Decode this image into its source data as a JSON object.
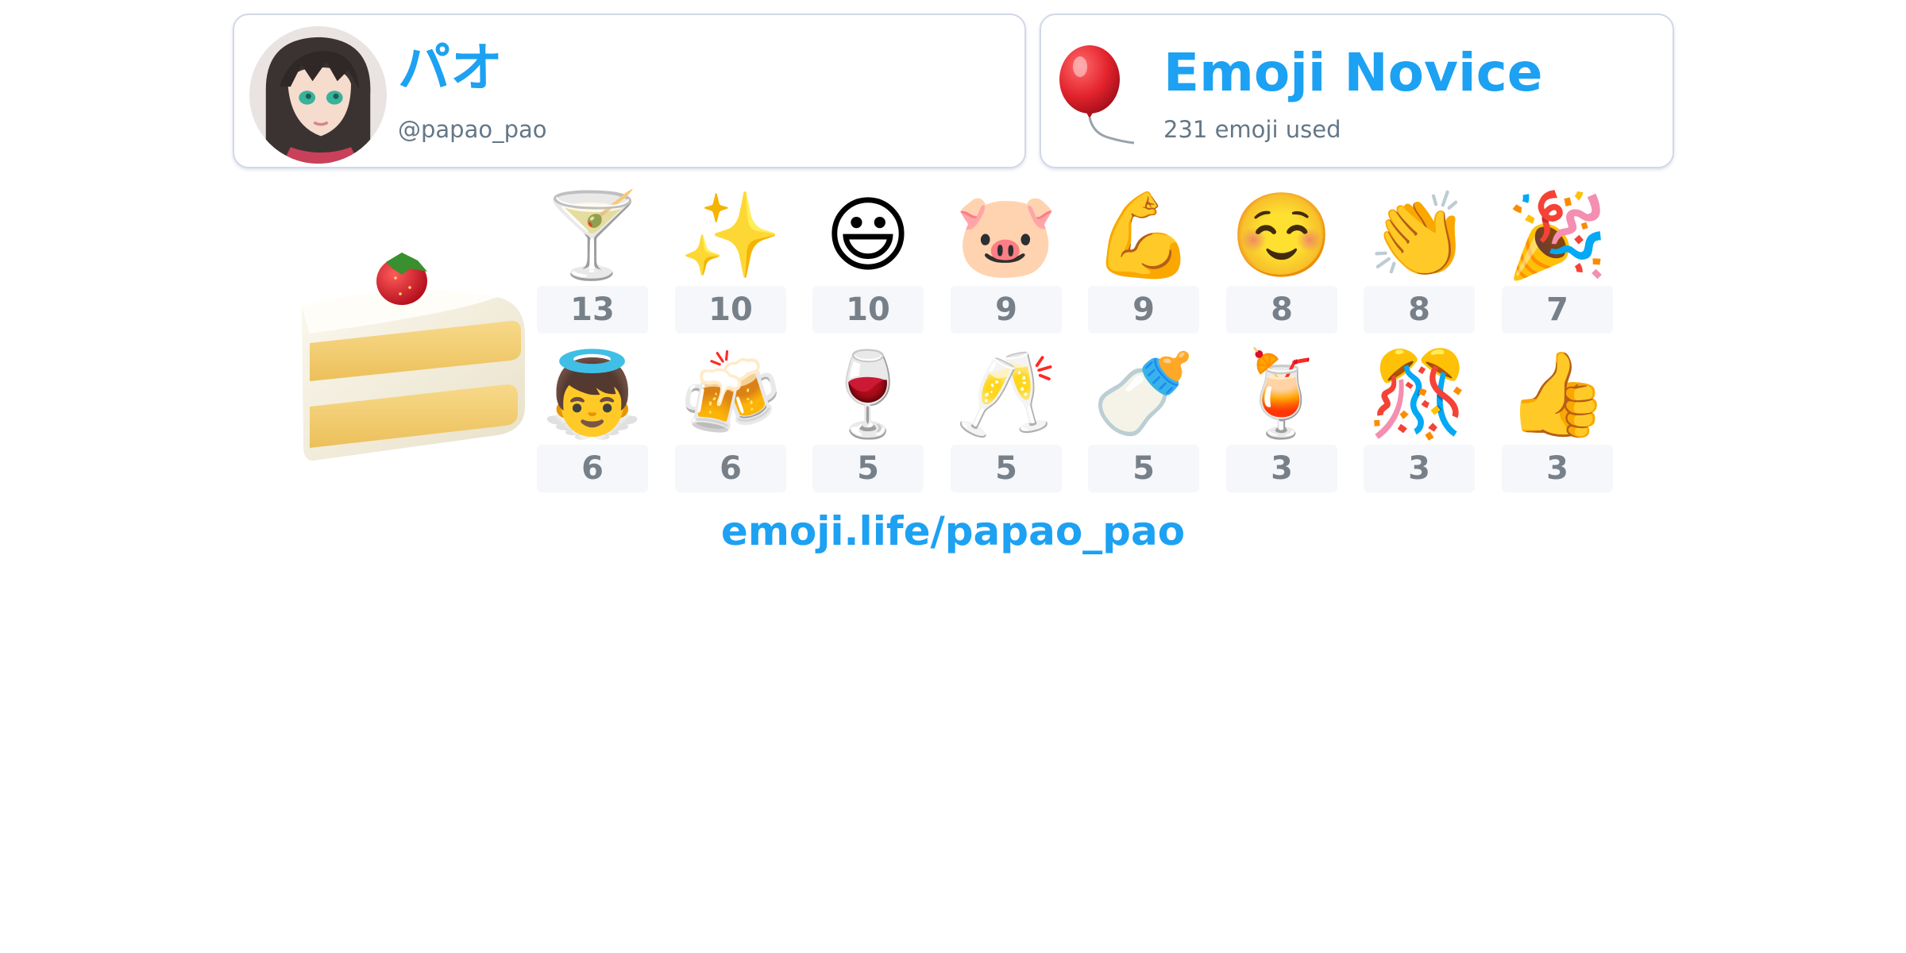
{
  "user": {
    "display_name": "パオ",
    "handle": "@papao_pao"
  },
  "rank": {
    "title": "Emoji Novice",
    "subtitle": "231 emoji used"
  },
  "featured_emoji": "🍰",
  "emoji_stats": [
    {
      "emoji": "🍸",
      "icon": "cocktail-glass-icon",
      "count": "13"
    },
    {
      "emoji": "✨",
      "icon": "sparkles-icon",
      "count": "10"
    },
    {
      "emoji": "😃",
      "icon": "grinning-face-icon",
      "count": "10"
    },
    {
      "emoji": "🐷",
      "icon": "pig-face-icon",
      "count": "9"
    },
    {
      "emoji": "💪",
      "icon": "flexed-biceps-icon",
      "count": "9"
    },
    {
      "emoji": "☺️",
      "icon": "smiling-face-icon",
      "count": "8"
    },
    {
      "emoji": "👏",
      "icon": "clapping-hands-icon",
      "count": "8"
    },
    {
      "emoji": "🎉",
      "icon": "party-popper-icon",
      "count": "7"
    },
    {
      "emoji": "👼",
      "icon": "baby-angel-icon",
      "count": "6"
    },
    {
      "emoji": "🍻",
      "icon": "clinking-beer-mugs-icon",
      "count": "6"
    },
    {
      "emoji": "🍷",
      "icon": "wine-glass-icon",
      "count": "5"
    },
    {
      "emoji": "🥂",
      "icon": "clinking-glasses-icon",
      "count": "5"
    },
    {
      "emoji": "🍼",
      "icon": "baby-bottle-icon",
      "count": "5"
    },
    {
      "emoji": "🍹",
      "icon": "tropical-drink-icon",
      "count": "3"
    },
    {
      "emoji": "🎊",
      "icon": "confetti-ball-icon",
      "count": "3"
    },
    {
      "emoji": "👍",
      "icon": "thumbs-up-icon",
      "count": "3"
    }
  ],
  "footer": {
    "profile_url": "emoji.life/papao_pao"
  },
  "colors": {
    "accent": "#1da1f2",
    "muted_text": "#657786",
    "count_text": "#778089",
    "count_bg": "#f5f7fa",
    "card_border": "#d3d8e6"
  }
}
